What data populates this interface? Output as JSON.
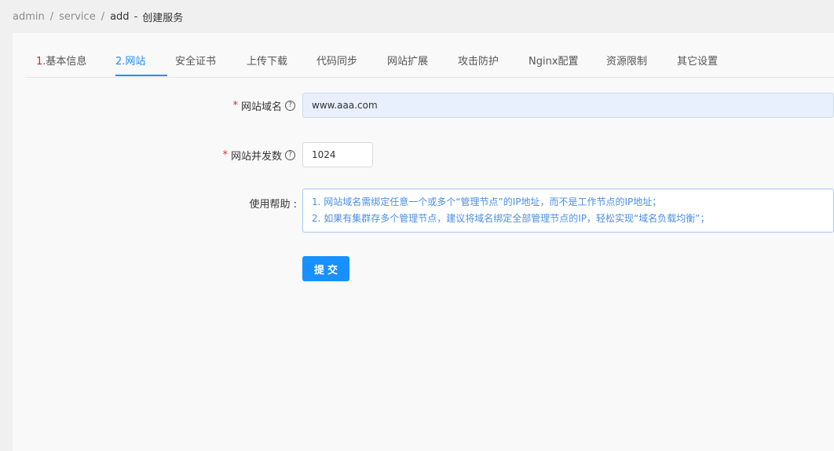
{
  "breadcrumb": {
    "items": [
      "admin",
      "service",
      "add"
    ],
    "separator": "/",
    "dash": "-",
    "page_title": "创建服务"
  },
  "tabs": [
    {
      "num": "1.",
      "label": "基本信息",
      "active": false
    },
    {
      "num": "2.",
      "label": "网站",
      "active": true
    },
    {
      "num": "",
      "label": "安全证书",
      "active": false
    },
    {
      "num": "",
      "label": "上传下载",
      "active": false
    },
    {
      "num": "",
      "label": "代码同步",
      "active": false
    },
    {
      "num": "",
      "label": "网站扩展",
      "active": false
    },
    {
      "num": "",
      "label": "攻击防护",
      "active": false
    },
    {
      "num": "",
      "label": "Nginx配置",
      "active": false
    },
    {
      "num": "",
      "label": "资源限制",
      "active": false
    },
    {
      "num": "",
      "label": "其它设置",
      "active": false
    }
  ],
  "form": {
    "required_mark": "*",
    "help_icon_glyph": "?",
    "domain": {
      "label": "网站域名",
      "value": "www.aaa.com"
    },
    "concurrency": {
      "label": "网站并发数",
      "value": "1024"
    },
    "usage_help": {
      "label": "使用帮助 :",
      "lines": [
        "1. 网站域名需绑定任意一个或多个“管理节点”的IP地址，而不是工作节点的IP地址；",
        "2. 如果有集群存多个管理节点，建议将域名绑定全部管理节点的IP，轻松实现“域名负载均衡”；"
      ]
    },
    "submit_label": "提交"
  },
  "colors": {
    "accent": "#1890ff",
    "step_number": "#e02424",
    "required": "#f5222d",
    "help_text": "#4a8fe7"
  }
}
